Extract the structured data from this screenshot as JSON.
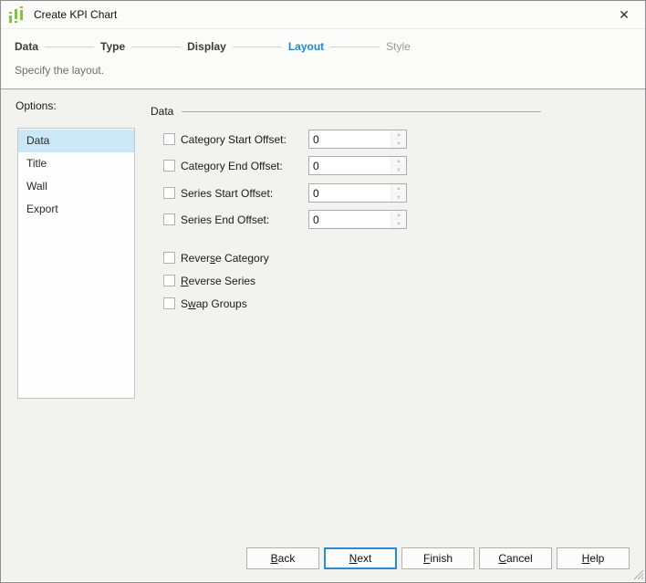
{
  "window": {
    "title": "Create KPI Chart",
    "close_glyph": "✕"
  },
  "steps": [
    {
      "label": "Data",
      "state": "completed"
    },
    {
      "label": "Type",
      "state": "completed"
    },
    {
      "label": "Display",
      "state": "completed"
    },
    {
      "label": "Layout",
      "state": "active"
    },
    {
      "label": "Style",
      "state": "upcoming"
    }
  ],
  "subtitle": "Specify the layout.",
  "options_panel": {
    "label": "Options:",
    "items": [
      {
        "label": "Data",
        "selected": true
      },
      {
        "label": "Title",
        "selected": false
      },
      {
        "label": "Wall",
        "selected": false
      },
      {
        "label": "Export",
        "selected": false
      }
    ]
  },
  "data_section": {
    "title": "Data",
    "offset_rows": [
      {
        "label": "Category Start Offset:",
        "value": "0",
        "checked": false
      },
      {
        "label": "Category End Offset:",
        "value": "0",
        "checked": false
      },
      {
        "label": "Series Start Offset:",
        "value": "0",
        "checked": false
      },
      {
        "label": "Series End Offset:",
        "value": "0",
        "checked": false
      }
    ],
    "toggles": [
      {
        "pre": "Rever",
        "mnemonic": "s",
        "post": "e Category",
        "checked": false
      },
      {
        "pre": "",
        "mnemonic": "R",
        "post": "everse Series",
        "checked": false
      },
      {
        "pre": "S",
        "mnemonic": "w",
        "post": "ap Groups",
        "checked": false
      }
    ]
  },
  "footer_buttons": [
    {
      "pre": "",
      "mnemonic": "B",
      "post": "ack",
      "default": false
    },
    {
      "pre": "",
      "mnemonic": "N",
      "post": "ext",
      "default": true
    },
    {
      "pre": "",
      "mnemonic": "F",
      "post": "inish",
      "default": false
    },
    {
      "pre": "",
      "mnemonic": "C",
      "post": "ancel",
      "default": false
    },
    {
      "pre": "",
      "mnemonic": "H",
      "post": "elp",
      "default": false
    }
  ],
  "icons": {
    "app_icon": "kpi-chart-icon",
    "spinner_up": "▲",
    "spinner_down": "▼"
  },
  "colors": {
    "accent_blue": "#1f87d2",
    "selected_item_bg": "#cbe8f6",
    "icon_green": "#82c341",
    "content_bg": "#f2f2ef",
    "header_bg": "#fbfcfa"
  }
}
